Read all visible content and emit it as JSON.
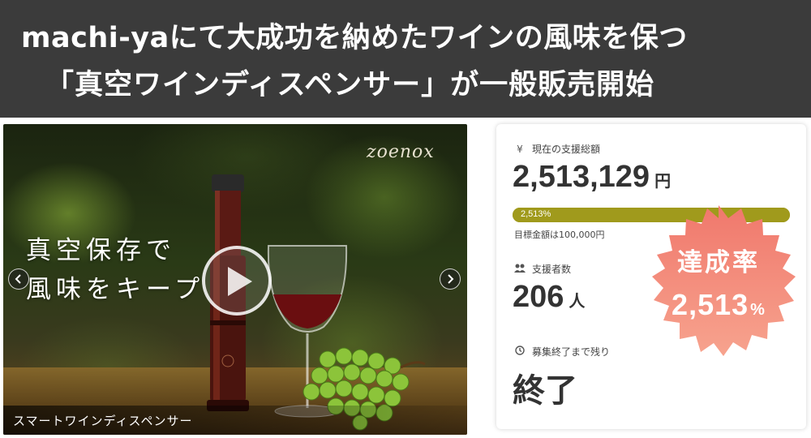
{
  "header": {
    "line1": "machi-yaにて大成功を納めたワインの風味を保つ",
    "line2": "「真空ワインディスペンサー」が一般販売開始"
  },
  "media": {
    "brand_logo": "zoenox",
    "copy_line1": "真空保存で",
    "copy_line2": "風味をキープ",
    "caption": "スマートワインディスペンサー",
    "prev_icon": "chevron-left-icon",
    "next_icon": "chevron-right-icon",
    "play_icon": "play-icon"
  },
  "stats": {
    "total_label": "現在の支援総額",
    "total_icon": "yen-icon",
    "total_amount": "2,513,129",
    "total_unit": "円",
    "progress_text": "2,513%",
    "progress_ratio": 1.0,
    "goal_text": "目標金額は100,000円",
    "supporters_label": "支援者数",
    "supporters_icon": "users-icon",
    "supporters_count": "206",
    "supporters_unit": "人",
    "remaining_label": "募集終了まで残り",
    "remaining_icon": "clock-icon",
    "remaining_value": "終了"
  },
  "badge": {
    "title": "達成率",
    "value": "2,513",
    "unit": "%"
  },
  "colors": {
    "banner_bg": "#3b3b3b",
    "progress": "#a09a1c",
    "badge_top": "#f0786c",
    "badge_bottom": "#f79a8a"
  }
}
